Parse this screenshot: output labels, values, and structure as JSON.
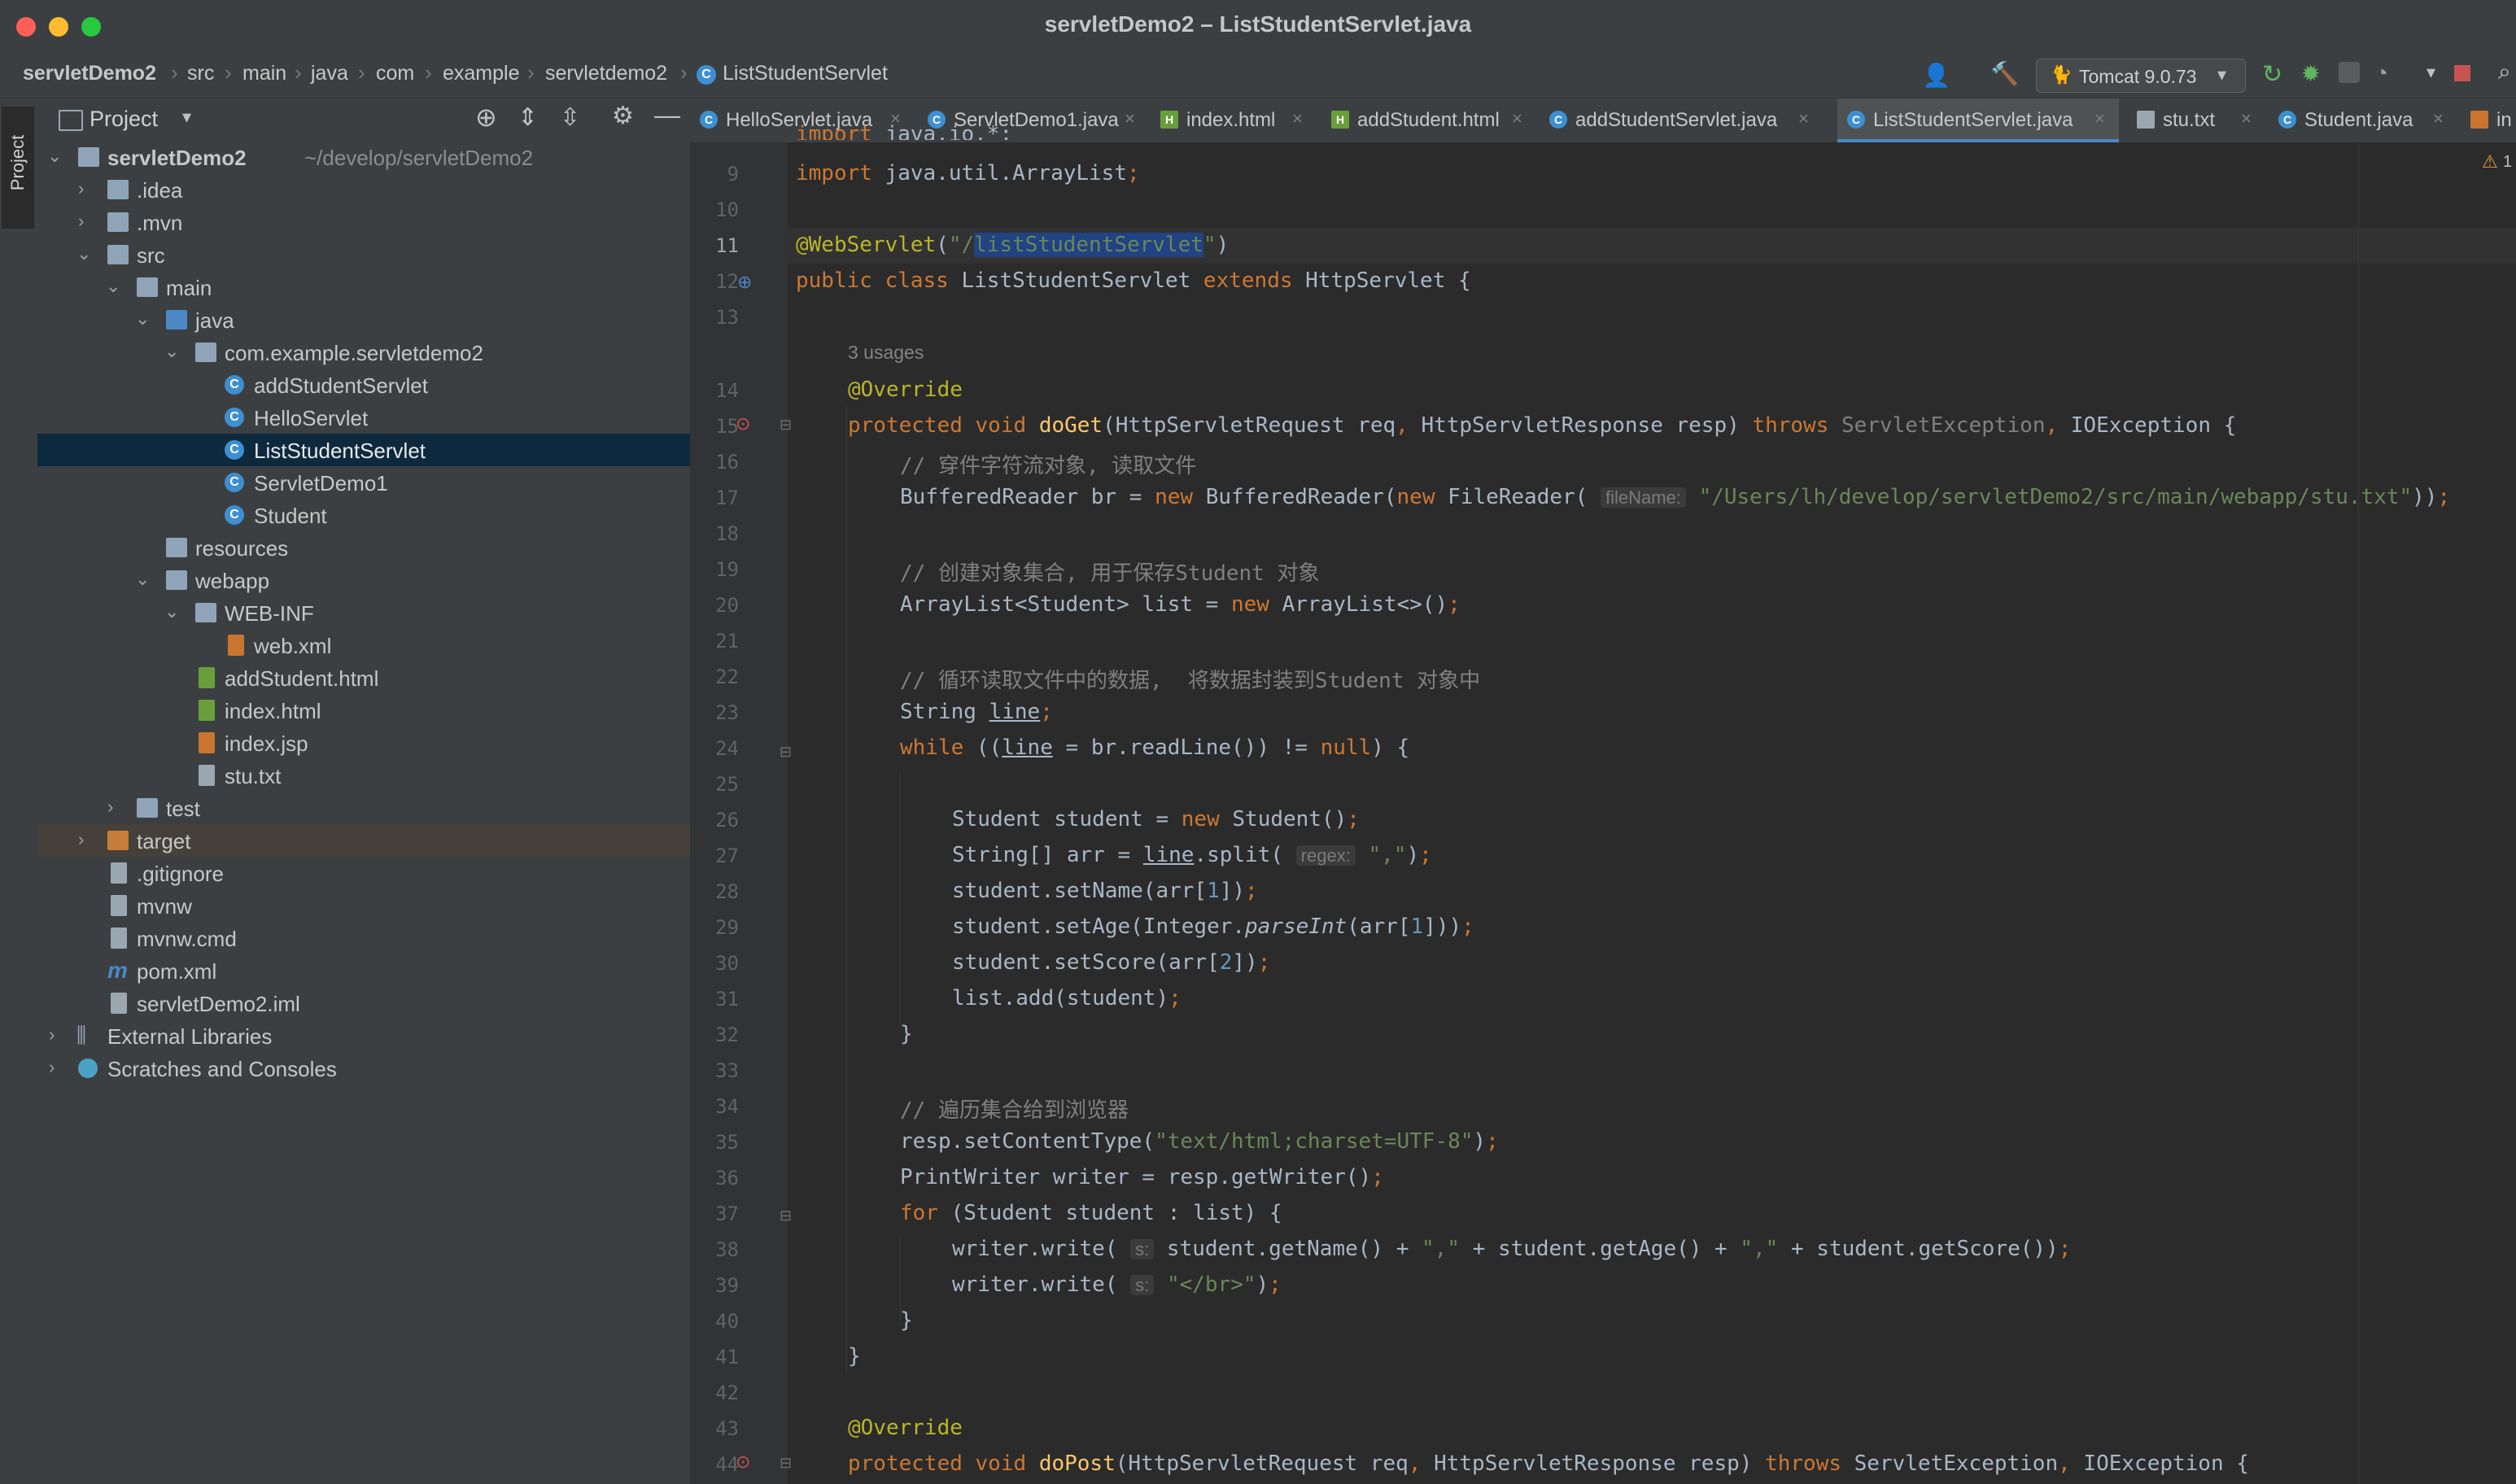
{
  "window": {
    "title": "servletDemo2 – ListStudentServlet.java"
  },
  "breadcrumb": [
    "servletDemo2",
    "src",
    "main",
    "java",
    "com",
    "example",
    "servletdemo2",
    "ListStudentServlet"
  ],
  "toolbar": {
    "run_config": "Tomcat 9.0.73"
  },
  "side_strip": {
    "label": "Project"
  },
  "project_panel": {
    "title": "Project",
    "root": "servletDemo2",
    "root_path": "~/develop/servletDemo2",
    "items": [
      {
        "label": ".idea"
      },
      {
        "label": ".mvn"
      },
      {
        "label": "src"
      },
      {
        "label": "main"
      },
      {
        "label": "java"
      },
      {
        "label": "com.example.servletdemo2"
      },
      {
        "label": "addStudentServlet"
      },
      {
        "label": "HelloServlet"
      },
      {
        "label": "ListStudentServlet"
      },
      {
        "label": "ServletDemo1"
      },
      {
        "label": "Student"
      },
      {
        "label": "resources"
      },
      {
        "label": "webapp"
      },
      {
        "label": "WEB-INF"
      },
      {
        "label": "web.xml"
      },
      {
        "label": "addStudent.html"
      },
      {
        "label": "index.html"
      },
      {
        "label": "index.jsp"
      },
      {
        "label": "stu.txt"
      },
      {
        "label": "test"
      },
      {
        "label": "target"
      },
      {
        "label": ".gitignore"
      },
      {
        "label": "mvnw"
      },
      {
        "label": "mvnw.cmd"
      },
      {
        "label": "pom.xml"
      },
      {
        "label": "servletDemo2.iml"
      },
      {
        "label": "External Libraries"
      },
      {
        "label": "Scratches and Consoles"
      }
    ]
  },
  "tabs": [
    {
      "label": "HelloServlet.java"
    },
    {
      "label": "ServletDemo1.java"
    },
    {
      "label": "index.html"
    },
    {
      "label": "addStudent.html"
    },
    {
      "label": "addStudentServlet.java"
    },
    {
      "label": "ListStudentServlet.java"
    },
    {
      "label": "stu.txt"
    },
    {
      "label": "Student.java"
    },
    {
      "label": "in"
    }
  ],
  "editor": {
    "warning_count": "1",
    "usages": "3 usages",
    "line_numbers": [
      "9",
      "10",
      "11",
      "12",
      "13",
      "14",
      "15",
      "16",
      "17",
      "18",
      "19",
      "20",
      "21",
      "22",
      "23",
      "24",
      "25",
      "26",
      "27",
      "28",
      "29",
      "30",
      "31",
      "32",
      "33",
      "34",
      "35",
      "36",
      "37",
      "38",
      "39",
      "40",
      "41",
      "42",
      "43",
      "44"
    ],
    "hints": {
      "fileName": "fileName:",
      "regex": "regex:",
      "s": "s:"
    },
    "strings": {
      "webservlet_path_prefix": "\"/",
      "webservlet_path_selected": "listStudentServlet",
      "webservlet_path_suffix": "\"",
      "file_path": "\"/Users/lh/develop/servletDemo2/src/main/webapp/stu.txt\"",
      "comma": "\",\"",
      "content_type": "\"text/html;charset=UTF-8\"",
      "br_tag": "\"</br>\""
    },
    "comments": {
      "c16": "// 穿件字符流对象, 读取文件",
      "c19": "// 创建对象集合, 用于保存Student 对象",
      "c22": "// 循环读取文件中的数据,  将数据封装到Student 对象中",
      "c34": "// 遍历集合给到浏览器"
    }
  },
  "colors": {
    "keyword": "#cc7832",
    "annotation": "#bbb529",
    "string": "#6a8759",
    "comment": "#808080",
    "method": "#ffc66d",
    "number": "#6897bb",
    "selection": "#214283",
    "accent": "#4a88c7"
  }
}
